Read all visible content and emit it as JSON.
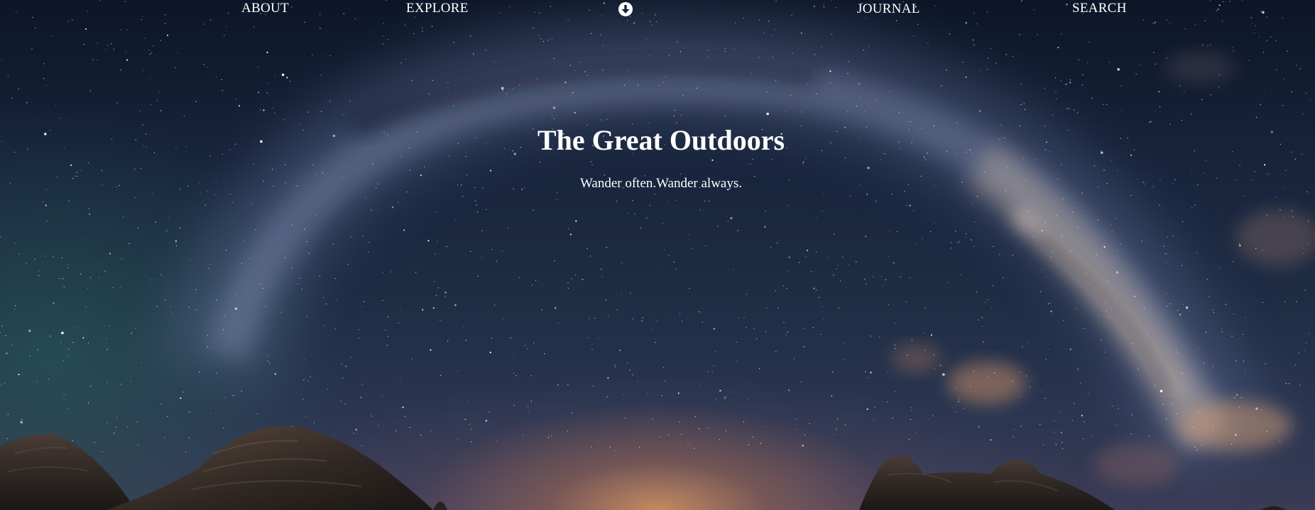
{
  "nav": {
    "items": [
      {
        "label": "ABOUT"
      },
      {
        "label": "EXPLORE"
      },
      {
        "label": "JOURNAL"
      },
      {
        "label": "SEARCH"
      }
    ],
    "logo_icon": "circle-arrow-down-icon"
  },
  "hero": {
    "title": "The Great Outdoors",
    "subtitle": "Wander often.Wander always."
  },
  "colors": {
    "text": "#ffffff",
    "sky_top": "#0d1628",
    "sky_mid": "#1f2d45",
    "horizon_glow": "#d69660",
    "rock": "#2a2522"
  }
}
